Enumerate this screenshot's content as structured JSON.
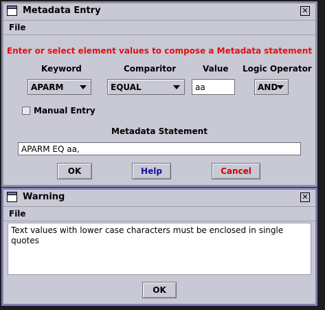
{
  "metadata_window": {
    "title": "Metadata Entry",
    "menu_file": "File",
    "instruction": "Enter or select element values to compose a Metadata statement",
    "labels": {
      "keyword": "Keyword",
      "comparitor": "Comparitor",
      "value": "Value",
      "logic_operator": "Logic Operator"
    },
    "keyword_selected": "APARM",
    "comparitor_selected": "EQUAL",
    "value_input": "aa",
    "logic_selected": "AND",
    "manual_entry_label": "Manual Entry",
    "manual_entry_checked": false,
    "statement_label": "Metadata Statement",
    "statement_value": "APARM EQ aa,",
    "buttons": {
      "ok": "OK",
      "help": "Help",
      "cancel": "Cancel"
    },
    "colors": {
      "instruction": "#e01010",
      "help": "#1010a0",
      "cancel": "#cc0000"
    }
  },
  "warning_window": {
    "title": "Warning",
    "menu_file": "File",
    "message": "Text values with lower case characters must be enclosed in single quotes",
    "ok_label": "OK"
  },
  "icons": {
    "window": "window-icon",
    "close": "close-icon",
    "dropdown": "chevron-down-icon"
  }
}
